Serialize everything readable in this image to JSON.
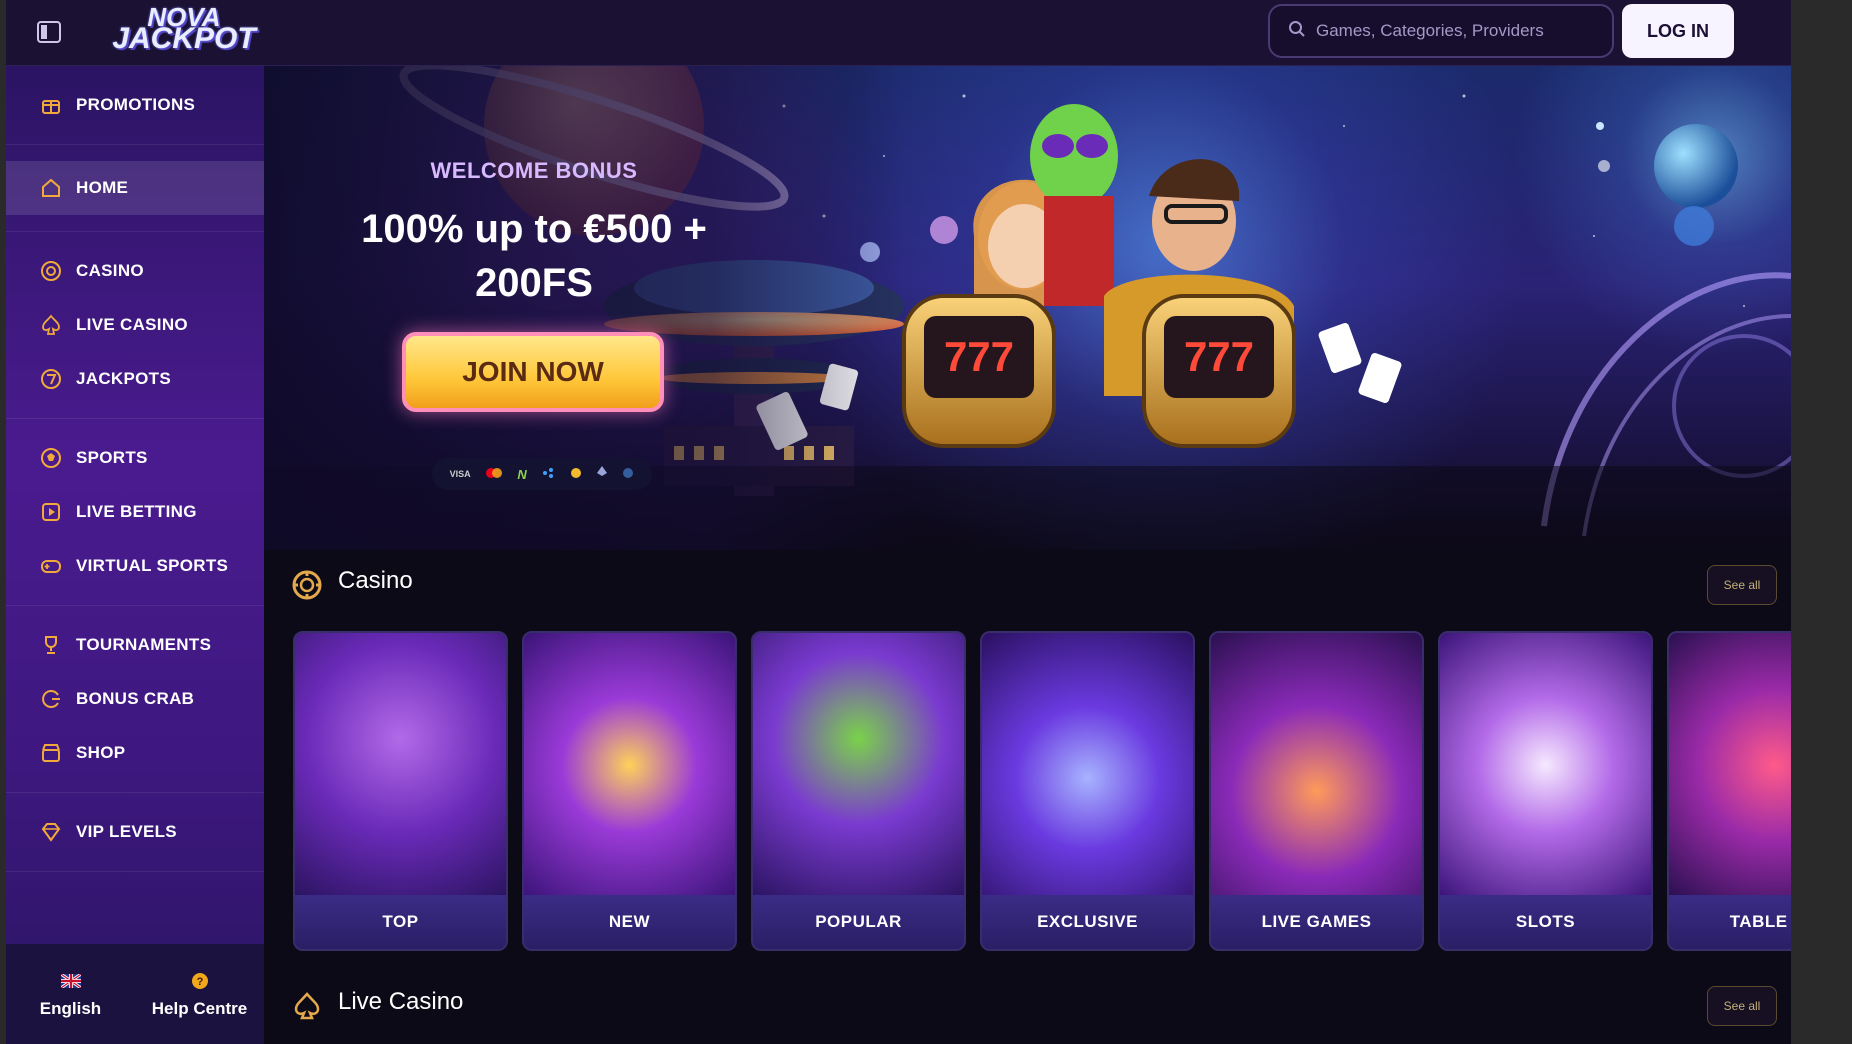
{
  "header": {
    "logo_line1": "NOVA",
    "logo_line2": "JACKPOT",
    "search_placeholder": "Games, Categories, Providers",
    "login_label": "LOG IN"
  },
  "sidebar": {
    "groups": [
      [
        {
          "label": "PROMOTIONS",
          "icon": "promotions-icon"
        }
      ],
      [
        {
          "label": "HOME",
          "icon": "home-icon",
          "active": true
        }
      ],
      [
        {
          "label": "CASINO",
          "icon": "casino-chip-icon"
        },
        {
          "label": "LIVE CASINO",
          "icon": "spade-icon"
        },
        {
          "label": "JACKPOTS",
          "icon": "jackpot-seven-icon"
        }
      ],
      [
        {
          "label": "SPORTS",
          "icon": "ball-icon"
        },
        {
          "label": "LIVE BETTING",
          "icon": "live-play-icon"
        },
        {
          "label": "VIRTUAL SPORTS",
          "icon": "gamepad-icon"
        }
      ],
      [
        {
          "label": "TOURNAMENTS",
          "icon": "trophy-icon"
        },
        {
          "label": "BONUS CRAB",
          "icon": "crab-claw-icon"
        },
        {
          "label": "SHOP",
          "icon": "shop-icon"
        }
      ],
      [
        {
          "label": "VIP LEVELS",
          "icon": "vip-gem-icon"
        }
      ]
    ],
    "footer": {
      "language_label": "English",
      "help_label": "Help Centre"
    }
  },
  "hero": {
    "eyebrow": "WELCOME BONUS",
    "title": "100% up to €500 + 200FS",
    "cta_label": "JOIN NOW",
    "payment_methods": [
      "VISA",
      "mastercard",
      "N",
      "crypto",
      "coin",
      "eth",
      "ltc"
    ],
    "slot_left": "777",
    "slot_right": "777"
  },
  "sections": {
    "casino": {
      "title": "Casino",
      "see_all": "See all"
    },
    "live_casino": {
      "title": "Live Casino",
      "see_all": "See all"
    }
  },
  "categories": [
    {
      "label": "TOP"
    },
    {
      "label": "NEW"
    },
    {
      "label": "POPULAR"
    },
    {
      "label": "EXCLUSIVE"
    },
    {
      "label": "LIVE GAMES"
    },
    {
      "label": "SLOTS"
    },
    {
      "label": "TABLE GA"
    }
  ],
  "colors": {
    "accent": "#ffc73a",
    "sidebar": "#4a1b8f",
    "background": "#0d0a18"
  }
}
